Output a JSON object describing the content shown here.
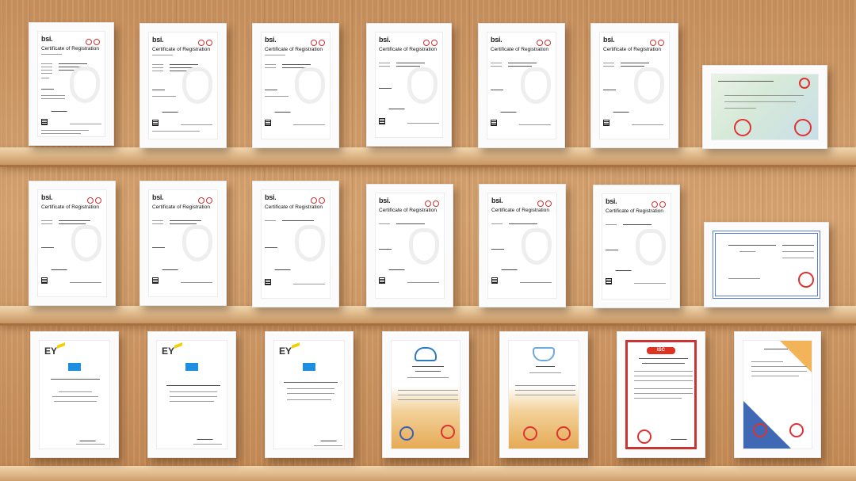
{
  "row1": [
    {
      "kind": "bsi",
      "logo": "bsi.",
      "title": "Certificate of Registration"
    },
    {
      "kind": "bsi",
      "logo": "bsi.",
      "title": "Certificate of Registration"
    },
    {
      "kind": "bsi",
      "logo": "bsi.",
      "title": "Certificate of Registration"
    },
    {
      "kind": "bsi",
      "logo": "bsi.",
      "title": "Certificate of Registration"
    },
    {
      "kind": "bsi",
      "logo": "bsi.",
      "title": "Certificate of Registration"
    },
    {
      "kind": "bsi",
      "logo": "bsi.",
      "title": "Certificate of Registration"
    },
    {
      "kind": "landscape-teal"
    }
  ],
  "row2": [
    {
      "kind": "bsi",
      "logo": "bsi.",
      "title": "Certificate of Registration"
    },
    {
      "kind": "bsi",
      "logo": "bsi.",
      "title": "Certificate of Registration"
    },
    {
      "kind": "bsi",
      "logo": "bsi.",
      "title": "Certificate of Registration"
    },
    {
      "kind": "bsi",
      "logo": "bsi.",
      "title": "Certificate of Registration"
    },
    {
      "kind": "bsi",
      "logo": "bsi.",
      "title": "Certificate of Registration"
    },
    {
      "kind": "bsi",
      "logo": "bsi.",
      "title": "Certificate of Registration"
    },
    {
      "kind": "landscape-blue-border"
    }
  ],
  "row3": [
    {
      "kind": "ey",
      "logo": "EY"
    },
    {
      "kind": "ey",
      "logo": "EY"
    },
    {
      "kind": "ey",
      "logo": "EY"
    },
    {
      "kind": "cn-gold"
    },
    {
      "kind": "cn-cream"
    },
    {
      "kind": "iso-red",
      "header": "ISC"
    },
    {
      "kind": "blue-orange"
    }
  ],
  "colors": {
    "wood_light": "#e2bd8f",
    "wood_dark": "#c48a55",
    "frame": "#fbfbfb",
    "bsi_seal": "#cc3333",
    "ey_yellow": "#f5d000",
    "ey_blue": "#1e8fe0"
  }
}
